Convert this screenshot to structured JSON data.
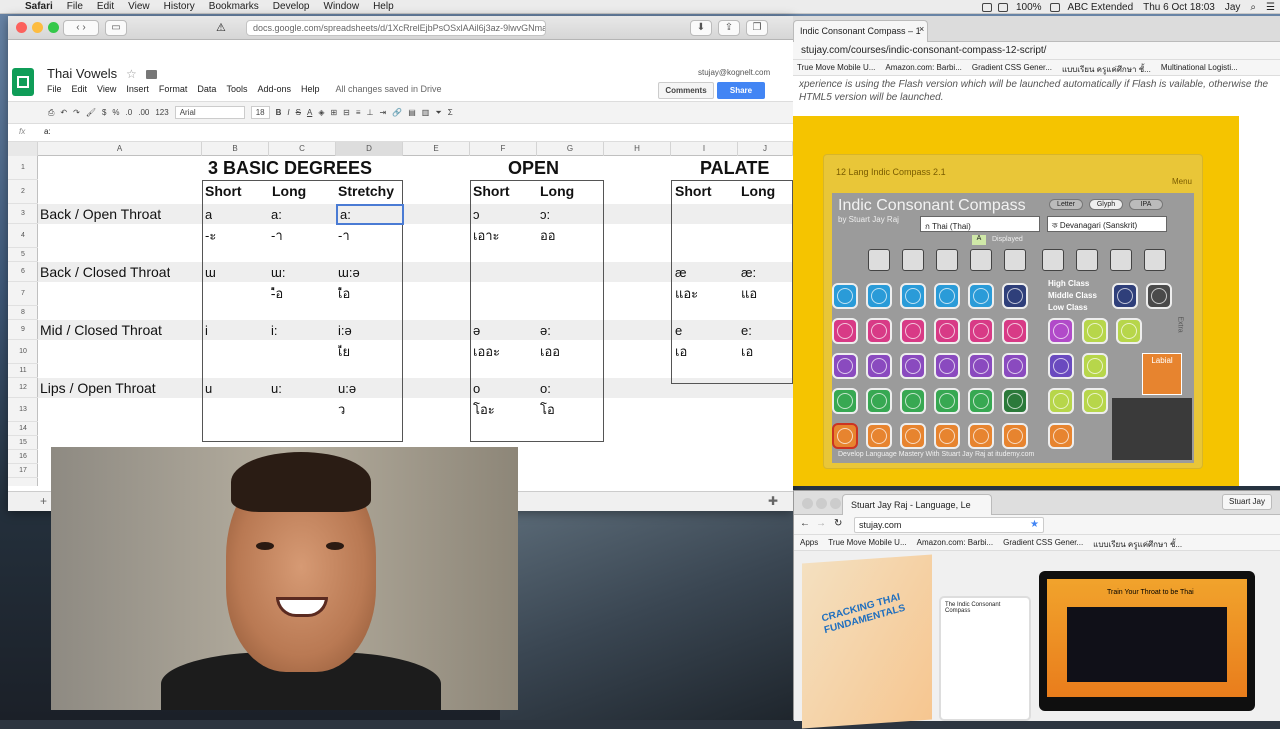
{
  "menubar": {
    "app": "Safari",
    "items": [
      "File",
      "Edit",
      "View",
      "History",
      "Bookmarks",
      "Develop",
      "Window",
      "Help"
    ],
    "battery": "100%",
    "input_source": "ABC Extended",
    "clock": "Thu 6 Oct 18:03",
    "user": "Jay"
  },
  "safari": {
    "url": "docs.google.com/spreadsheets/d/1XcRrelEjbPsOSxlAAil6j3az-9lwvGNma"
  },
  "sheets": {
    "title": "Thai Vowels",
    "menus": [
      "File",
      "Edit",
      "View",
      "Insert",
      "Format",
      "Data",
      "Tools",
      "Add-ons",
      "Help"
    ],
    "saved": "All changes saved in Drive",
    "user_email": "stujay@kognelt.com",
    "comments": "Comments",
    "share": "Share",
    "font": "Arial",
    "font_size": "18",
    "fmt_dollar": "$",
    "fmt_percent": "%",
    "fmt_dec0": ".0",
    "fmt_dec00": ".00",
    "fmt_123": "123",
    "fx_label": "fx",
    "cell_value": "a:",
    "columns": [
      "A",
      "B",
      "C",
      "D",
      "E",
      "F",
      "G",
      "H",
      "I",
      "J"
    ],
    "rows": [
      "1",
      "2",
      "3",
      "4",
      "5",
      "6",
      "7",
      "8",
      "9",
      "10",
      "11",
      "12",
      "13",
      "14",
      "15",
      "16",
      "17"
    ],
    "headers": {
      "basic": "3 BASIC DEGREES",
      "open": "OPEN",
      "palate": "PALATE"
    },
    "sub": {
      "short": "Short",
      "long": "Long",
      "stretchy": "Stretchy"
    },
    "labels": {
      "r3": "Back / Open Throat",
      "r6": "Back / Closed Throat",
      "r9": "Mid / Closed Throat",
      "r12": "Lips / Open Throat"
    },
    "cells": {
      "b3": "a",
      "c3": "a:",
      "d3": "a:",
      "f3": "ɔ",
      "g3": "ɔ:",
      "b4": "-ะ",
      "c4": "-า",
      "d4": "-า",
      "f4": "เอาะ",
      "g4": "ออ",
      "b6": "ɯ",
      "c6": "ɯ:",
      "d6": "ɯ:ə",
      "i6": "æ",
      "j6": "æ:",
      "b7": "ึ",
      "c7": "-ือ",
      "d7": "เือ",
      "i7": "แอะ",
      "j7": "แอ",
      "b9": "i",
      "c9": "i:",
      "d9": "i:ə",
      "f9": "ə",
      "g9": "ə:",
      "i9": "e",
      "j9": "e:",
      "b10": "ิ",
      "c10": "ี",
      "d10": "เีย",
      "f10": "เออะ",
      "g10": "เออ",
      "i10": "เอ",
      "j10": "เอ",
      "b12": "u",
      "c12": "u:",
      "d12": "u:ə",
      "f12": "o",
      "g12": "o:",
      "b13": "ุ",
      "c13": "ู",
      "d13": "ัว",
      "f13": "โอะ",
      "g13": "โอ"
    }
  },
  "right_window": {
    "tab": "Indic Consonant Compass – 1",
    "url": "stujay.com/courses/indic-consonant-compass-12-script/",
    "bookmarks": [
      "True Move Mobile U...",
      "Amazon.com: Barbi...",
      "Gradient CSS Gener...",
      "แบบเรียน ครูแค่ศึกษา ชั้...",
      "Multinational Logisti..."
    ],
    "notice": "xperience is using the Flash version which will be launched automatically if Flash is vailable, otherwise the HTML5 version will be launched.",
    "compass_header": "12 Lang Indic Compass 2.1",
    "menu": "Menu",
    "panel_title": "Indic Consonant Compass",
    "panel_sub": "by Stuart Jay Raj",
    "toggles": [
      "Letter",
      "Glyph",
      "IPA"
    ],
    "dropdown_left": "ก  Thai (Thai)",
    "dropdown_right": "ক  Devanagari (Sanskrit)",
    "displayed_label": "A",
    "displayed": "Displayed",
    "classes": [
      "High Class",
      "Middle Class",
      "Low Class"
    ],
    "labial": "Labial",
    "extra": "Extra",
    "footer": "Develop Language Mastery With Stuart Jay Raj at itudemy.com"
  },
  "chrome_window": {
    "tab": "Stuart Jay Raj - Language, Le",
    "profile": "Stuart Jay",
    "url": "stujay.com",
    "bookmarks": [
      "Apps",
      "True Move Mobile U...",
      "Amazon.com: Barbi...",
      "Gradient CSS Gener...",
      "แบบเรียน ครูแค่ศึกษา ชั้..."
    ],
    "book_title": "CRACKING THAI FUNDAMENTALS",
    "tablet_title": "The Indic Consonant Compass",
    "laptop_title": "Train Your Throat to be Thai"
  }
}
